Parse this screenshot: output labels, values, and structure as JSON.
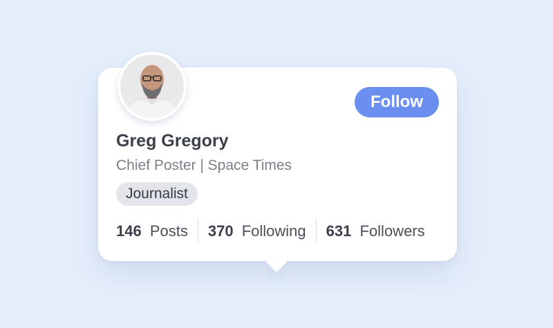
{
  "profile": {
    "name": "Greg Gregory",
    "subtitle": "Chief Poster | Space Times",
    "badge": "Journalist",
    "follow_label": "Follow"
  },
  "stats": [
    {
      "count": "146",
      "label": "Posts"
    },
    {
      "count": "370",
      "label": "Following"
    },
    {
      "count": "631",
      "label": "Followers"
    }
  ],
  "colors": {
    "background": "#e4eefb",
    "accent": "#6b8ff1",
    "badge_bg": "#e3e5ea"
  }
}
